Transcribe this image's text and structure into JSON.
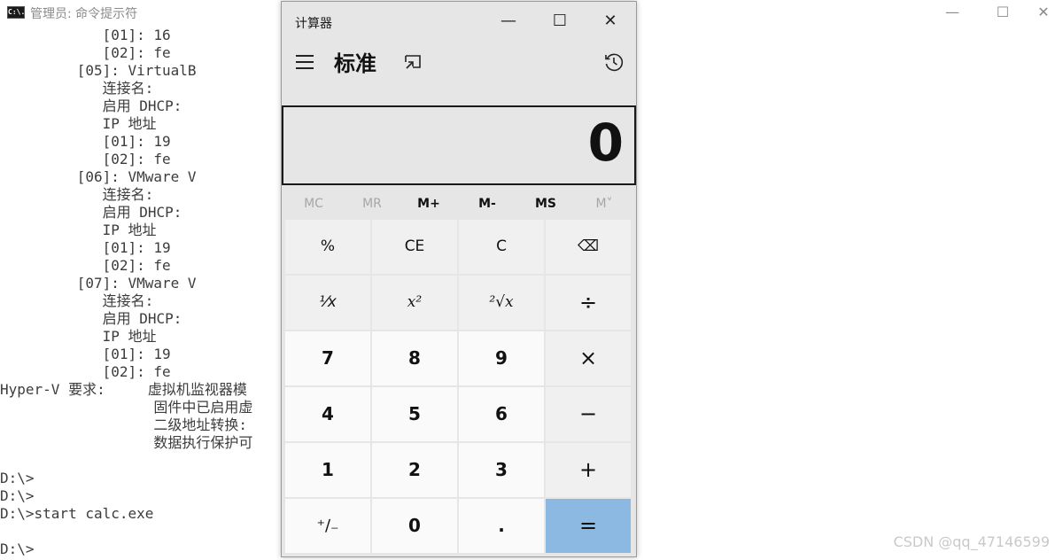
{
  "console": {
    "title": "管理员: 命令提示符",
    "icon_text": "C:\\.",
    "controls": {
      "minimize": "—",
      "maximize": "☐",
      "close": "✕"
    },
    "lines": [
      "            [01]: 16",
      "            [02]: fe",
      "         [05]: VirtualB",
      "            连接名:",
      "            启用 DHCP:",
      "            IP 地址",
      "            [01]: 19",
      "            [02]: fe",
      "         [06]: VMware V",
      "            连接名:",
      "            启用 DHCP:",
      "            IP 地址",
      "            [01]: 19",
      "            [02]: fe",
      "         [07]: VMware V",
      "            连接名:",
      "            启用 DHCP:",
      "            IP 地址",
      "            [01]: 19",
      "            [02]: fe",
      "Hyper-V 要求:     虚拟机监视器模",
      "                  固件中已启用虚",
      "                  二级地址转换:",
      "                  数据执行保护可",
      "",
      "D:\\>",
      "D:\\>",
      "D:\\>start calc.exe",
      "",
      "D:\\>"
    ],
    "watermark": "CSDN @qq_47146599"
  },
  "calculator": {
    "title": "计算器",
    "window_controls": {
      "minimize": "—",
      "maximize": "☐",
      "close": "✕"
    },
    "mode": "标准",
    "display": "0",
    "memory": {
      "mc": "MC",
      "mr": "MR",
      "mplus": "M+",
      "mminus": "M-",
      "ms": "MS",
      "mlist": "M˅"
    },
    "keys": {
      "percent": "%",
      "ce": "CE",
      "clear": "C",
      "backspace": "⌫",
      "reciprocal": "⅟x",
      "square": "x²",
      "sqrt": "²√x",
      "divide": "÷",
      "seven": "7",
      "eight": "8",
      "nine": "9",
      "multiply": "×",
      "four": "4",
      "five": "5",
      "six": "6",
      "minus": "−",
      "one": "1",
      "two": "2",
      "three": "3",
      "plus": "+",
      "negate": "⁺∕₋",
      "zero": "0",
      "decimal": ".",
      "equals": "="
    }
  }
}
